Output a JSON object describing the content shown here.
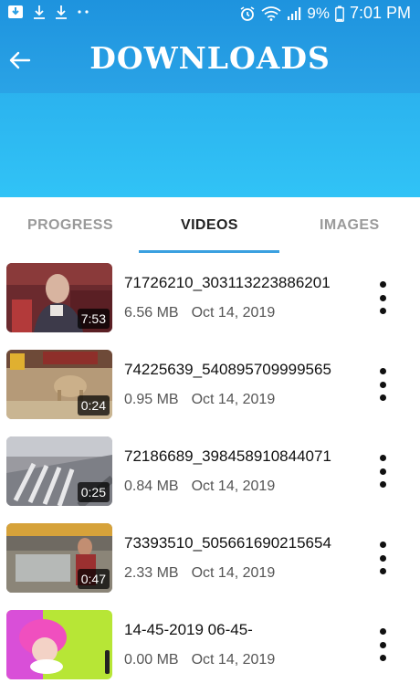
{
  "status_bar": {
    "battery_percent": "9%",
    "time": "7:01 PM",
    "left_icons": [
      "download-box-icon",
      "download-icon",
      "download-icon",
      "more-dots-icon"
    ],
    "right_icons": [
      "alarm-icon",
      "wifi-icon",
      "signal-icon",
      "battery-icon"
    ]
  },
  "header": {
    "title": "DOWNLOADS",
    "back_icon": "arrow-left-icon",
    "color_top": "#1e93de",
    "color_bottom": "#31c3f6"
  },
  "tabs": [
    {
      "label": "PROGRESS",
      "active": false
    },
    {
      "label": "VIDEOS",
      "active": true
    },
    {
      "label": "IMAGES",
      "active": false
    }
  ],
  "accent_color": "#3aa0e0",
  "videos": [
    {
      "name": "71726210_303113223886201",
      "size": "6.56 MB",
      "date": "Oct 14, 2019",
      "duration": "7:53"
    },
    {
      "name": "74225639_540895709999565",
      "size": "0.95 MB",
      "date": "Oct 14, 2019",
      "duration": "0:24"
    },
    {
      "name": "72186689_398458910844071",
      "size": "0.84 MB",
      "date": "Oct 14, 2019",
      "duration": "0:25"
    },
    {
      "name": "73393510_505661690215654",
      "size": "2.33 MB",
      "date": "Oct 14, 2019",
      "duration": "0:47"
    },
    {
      "name": "14-45-2019 06-45-",
      "size": "0.00 MB",
      "date": "Oct 14, 2019",
      "duration": ""
    }
  ]
}
